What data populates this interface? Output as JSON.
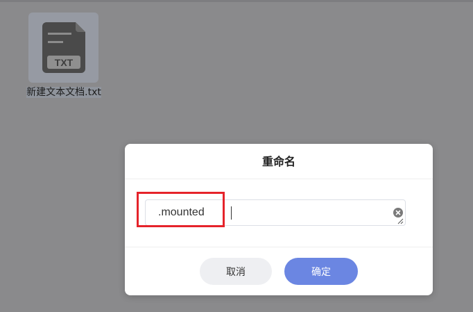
{
  "desktop": {
    "file": {
      "badge": "TXT",
      "name": "新建文本文档.txt"
    }
  },
  "dialog": {
    "title": "重命名",
    "input_value": ".mounted",
    "cancel_label": "取消",
    "confirm_label": "确定"
  },
  "colors": {
    "accent": "#6b86e2",
    "highlight": "#e5232a",
    "overlay": "#8a8a8c"
  },
  "icons": {
    "file": "txt-file-icon",
    "clear": "clear-circle-icon",
    "resize": "resize-handle-icon"
  }
}
